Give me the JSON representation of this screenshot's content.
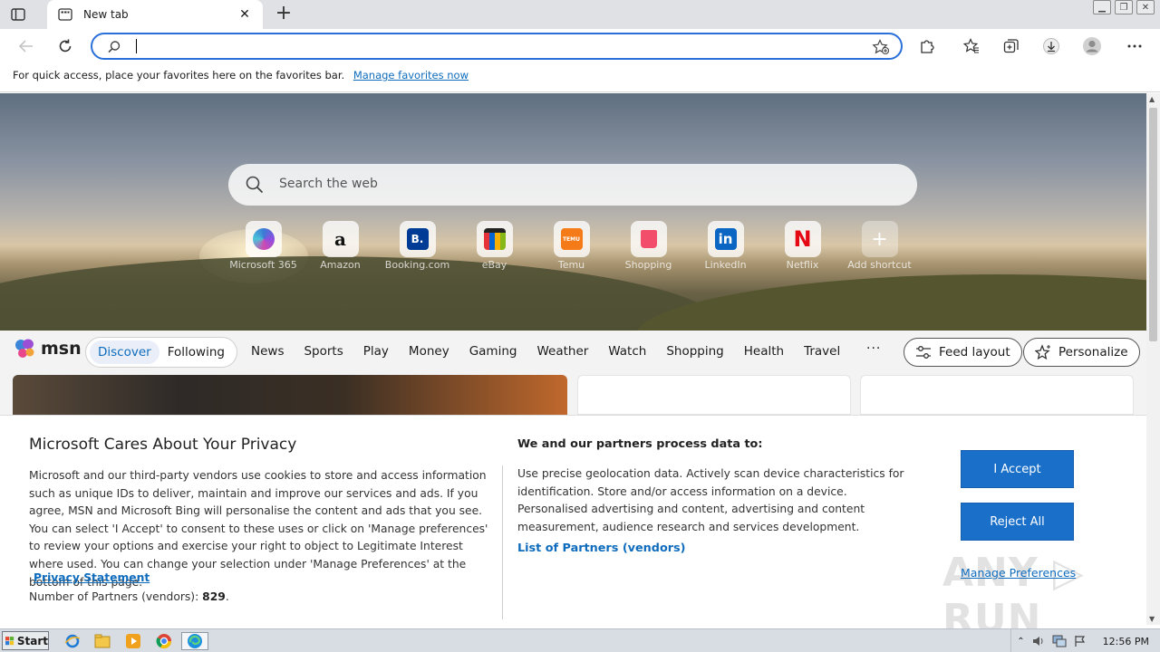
{
  "browser": {
    "tab_title": "New tab",
    "newtab_symbol": "+",
    "address_placeholder": "",
    "favorites_bar": {
      "text": "For quick access, place your favorites here on the favorites bar.",
      "link": "Manage favorites now"
    }
  },
  "ntp": {
    "search_placeholder": "Search the web",
    "shortcuts": [
      {
        "label": "Microsoft 365",
        "color": "#6b54d1",
        "glyph": ""
      },
      {
        "label": "Amazon",
        "color": "#ffffff",
        "glyph": "a"
      },
      {
        "label": "Booking.com",
        "color": "#003b95",
        "glyph": "B."
      },
      {
        "label": "eBay",
        "color": "#e53238",
        "glyph": ""
      },
      {
        "label": "Temu",
        "color": "#f57a18",
        "glyph": "TEMU"
      },
      {
        "label": "Shopping",
        "color": "#f24d6b",
        "glyph": ""
      },
      {
        "label": "LinkedIn",
        "color": "#0a66c2",
        "glyph": "in"
      },
      {
        "label": "Netflix",
        "color": "#e50914",
        "glyph": "N"
      },
      {
        "label": "Add shortcut",
        "color": "",
        "glyph": "+"
      }
    ]
  },
  "msn": {
    "logo_text": "msn",
    "segments": [
      "Discover",
      "Following"
    ],
    "nav": [
      "News",
      "Sports",
      "Play",
      "Money",
      "Gaming",
      "Weather",
      "Watch",
      "Shopping",
      "Health",
      "Travel"
    ],
    "more": "···",
    "feed_layout": "Feed layout",
    "personalize": "Personalize"
  },
  "privacy": {
    "title": "Microsoft Cares About Your Privacy",
    "body": "Microsoft and our third-party vendors use cookies to store and access information such as unique IDs to deliver, maintain and improve our services and ads. If you agree, MSN and Microsoft Bing will personalise the content and ads that you see. You can select 'I Accept' to consent to these uses or click on 'Manage preferences' to review your options and exercise your right to object to Legitimate Interest where used.  You can change your selection under 'Manage Preferences' at the bottom of this page.",
    "privacy_link": "Privacy Statement",
    "partners_label": "Number of Partners (vendors): ",
    "partners_count": "829",
    "partners_end": ".",
    "dot": ".",
    "sub_title": "We and our partners process data to:",
    "sub_body": "Use precise geolocation data. Actively scan device characteristics for identification. Store and/or access information on a device. Personalised advertising and content, advertising and content measurement, audience research and services development.",
    "vendors_link": "List of Partners (vendors)",
    "accept": "I Accept",
    "reject": "Reject All",
    "manage": "Manage Preferences"
  },
  "watermark": "ANY RUN",
  "taskbar": {
    "start": "Start",
    "clock": "12:56 PM"
  },
  "colors": {
    "accent": "#0f6cbd",
    "button_blue": "#1a6fc9"
  }
}
